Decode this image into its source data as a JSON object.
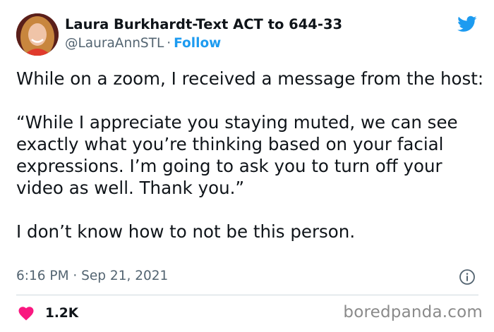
{
  "tweet": {
    "author_name": "Laura Burkhardt-Text ACT to 644-33",
    "handle": "@LauraAnnSTL",
    "separator": "·",
    "follow_label": "Follow",
    "paragraphs": [
      "While on a zoom, I received a message from the host:",
      "“While I appreciate you staying muted, we can see exactly what you’re thinking based on your facial expressions. I’m going to ask you to turn off your video as well. Thank you.”",
      "I don’t know how to not be this person."
    ],
    "timestamp": "6:16 PM · Sep 21, 2021",
    "like_count": "1.2K"
  },
  "icons": {
    "brand": "twitter-bird-icon",
    "info": "info-icon",
    "like": "heart-icon",
    "avatar": "profile-photo"
  },
  "colors": {
    "link_blue": "#1d9bf0",
    "heart_pink": "#f91880",
    "secondary_text": "#536471",
    "primary_text": "#0f1419"
  },
  "watermark": "boredpanda.com"
}
